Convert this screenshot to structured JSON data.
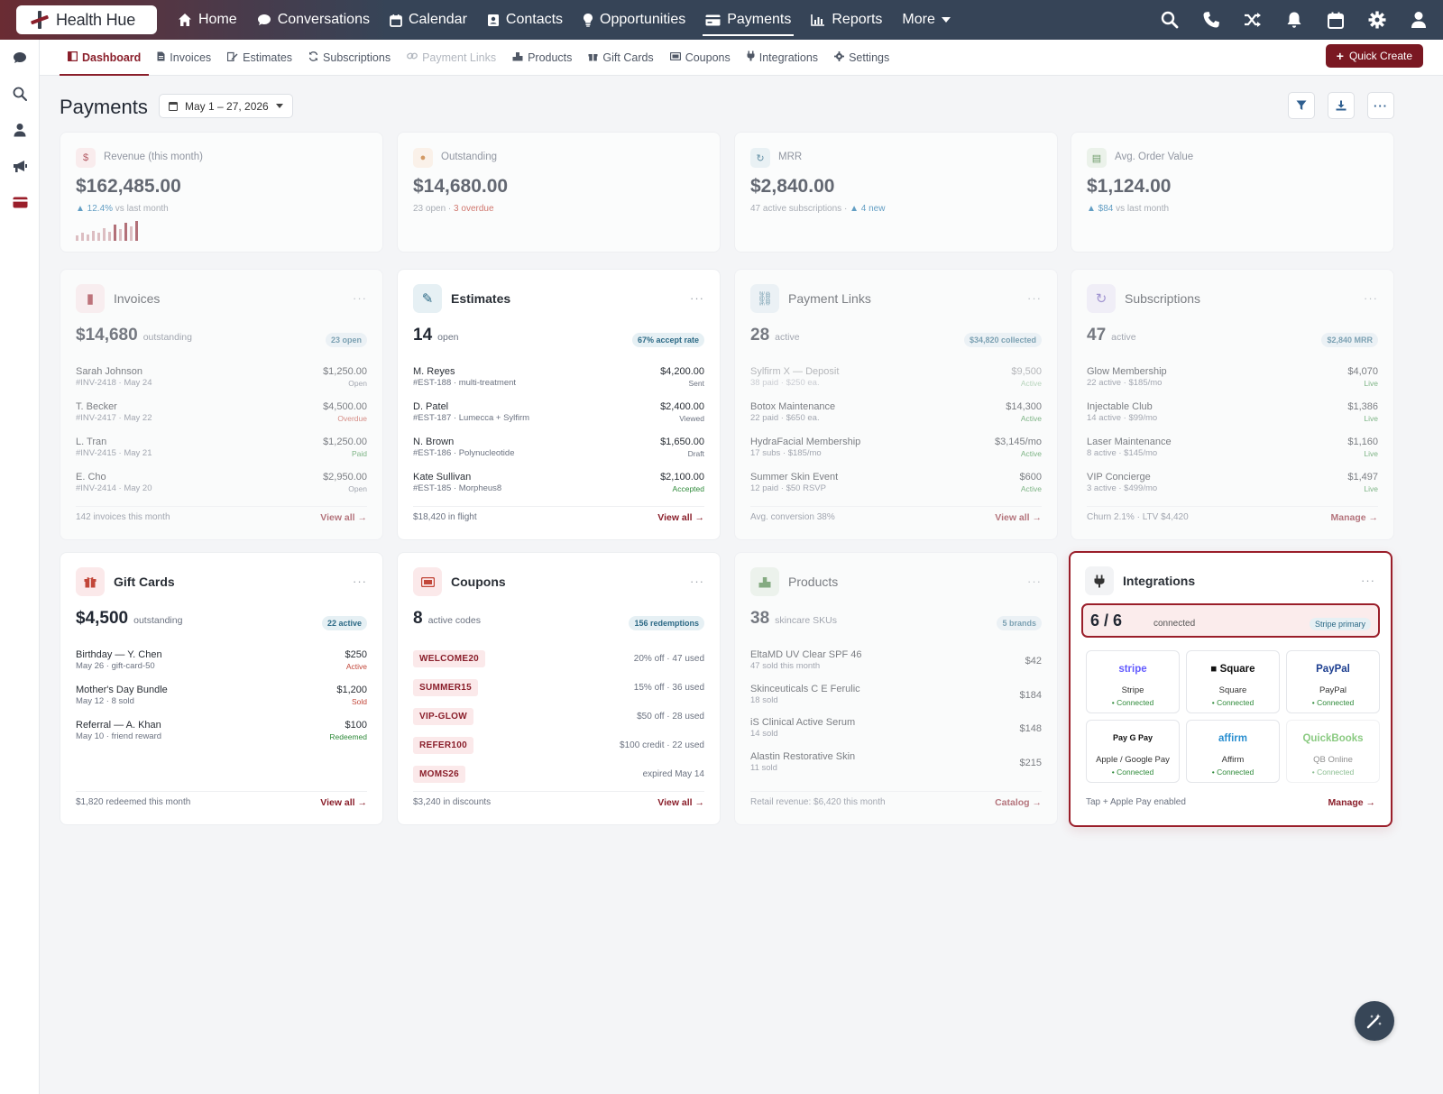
{
  "app": {
    "logo": "Health Hue"
  },
  "topnav": {
    "items": [
      {
        "label": "Home",
        "icon": "home-icon"
      },
      {
        "label": "Conversations",
        "icon": "chat-icon"
      },
      {
        "label": "Calendar",
        "icon": "calendar-icon"
      },
      {
        "label": "Contacts",
        "icon": "contacts-icon"
      },
      {
        "label": "Opportunities",
        "icon": "lightbulb-icon"
      },
      {
        "label": "Payments",
        "icon": "credit-card-icon"
      },
      {
        "label": "Reports",
        "icon": "bar-chart-icon"
      },
      {
        "label": "More",
        "icon": "chevron-down-icon"
      }
    ],
    "active": "Payments"
  },
  "subnav": {
    "items": [
      {
        "label": "Dashboard",
        "icon": "dashboard-icon"
      },
      {
        "label": "Invoices",
        "icon": "invoice-icon"
      },
      {
        "label": "Estimates",
        "icon": "estimate-icon"
      },
      {
        "label": "Subscriptions",
        "icon": "refresh-icon"
      },
      {
        "label": "Payment Links",
        "icon": "link-icon"
      },
      {
        "label": "Products",
        "icon": "products-icon"
      },
      {
        "label": "Gift Cards",
        "icon": "gift-icon"
      },
      {
        "label": "Coupons",
        "icon": "ticket-icon"
      },
      {
        "label": "Integrations",
        "icon": "plug-icon"
      },
      {
        "label": "Settings",
        "icon": "gear-icon"
      }
    ],
    "quick_create": "Quick Create"
  },
  "page": {
    "title": "Payments",
    "date_range": "May 1 – 27, 2026"
  },
  "stats": [
    {
      "label": "Revenue (this month)",
      "value": "$162,485.00",
      "sub_a": "▲ 12.4%",
      "sub_b": " vs last month"
    },
    {
      "label": "Outstanding",
      "value": "$14,680.00",
      "sub_a": "23 open · ",
      "sub_b": "3 overdue"
    },
    {
      "label": "MRR",
      "value": "$2,840.00",
      "sub_a": "47 active subscriptions · ",
      "sub_b": "▲ 4 new"
    },
    {
      "label": "Avg. Order Value",
      "value": "$1,124.00",
      "sub_a": "▲ $84",
      "sub_b": " vs last month"
    }
  ],
  "revenue_spark": [
    6,
    9,
    7,
    11,
    9,
    14,
    10,
    18,
    13,
    20,
    16,
    22
  ],
  "invoices": {
    "title": "Invoices",
    "big": "$14,680",
    "big_sub": "outstanding",
    "badge": "23 open",
    "rows": [
      {
        "name": "Sarah Johnson",
        "meta": "#INV-2418 · May 24",
        "amount": "$1,250.00",
        "status": "Open"
      },
      {
        "name": "T. Becker",
        "meta": "#INV-2417 · May 22",
        "amount": "$4,500.00",
        "status": "Overdue"
      },
      {
        "name": "L. Tran",
        "meta": "#INV-2415 · May 21",
        "amount": "$1,250.00",
        "status": "Paid"
      },
      {
        "name": "E. Cho",
        "meta": "#INV-2414 · May 20",
        "amount": "$2,950.00",
        "status": "Open"
      }
    ],
    "foot_left": "142 invoices this month",
    "foot_right": "View all →"
  },
  "estimates": {
    "title": "Estimates",
    "big": "14",
    "big_sub": "open",
    "badge": "67% accept rate",
    "rows": [
      {
        "name": "M. Reyes",
        "meta": "#EST-188 · multi-treatment",
        "amount": "$4,200.00",
        "status": "Sent"
      },
      {
        "name": "D. Patel",
        "meta": "#EST-187 · Lumecca + Sylfirm",
        "amount": "$2,400.00",
        "status": "Viewed"
      },
      {
        "name": "N. Brown",
        "meta": "#EST-186 · Polynucleotide",
        "amount": "$1,650.00",
        "status": "Draft"
      },
      {
        "name": "Kate Sullivan",
        "meta": "#EST-185 · Morpheus8",
        "amount": "$2,100.00",
        "status": "Accepted"
      }
    ],
    "foot_left": "$18,420 in flight",
    "foot_right": "View all →"
  },
  "payment_links": {
    "title": "Payment Links",
    "big": "28",
    "big_sub": "active",
    "badge": "$34,820 collected",
    "rows": [
      {
        "name": "Sylfirm X — Deposit",
        "meta": "38 paid · $250 ea.",
        "amount": "$9,500",
        "status": "Active"
      },
      {
        "name": "Botox Maintenance",
        "meta": "22 paid · $650 ea.",
        "amount": "$14,300",
        "status": "Active"
      },
      {
        "name": "HydraFacial Membership",
        "meta": "17 subs · $185/mo",
        "amount": "$3,145/mo",
        "status": "Active"
      },
      {
        "name": "Summer Skin Event",
        "meta": "12 paid · $50 RSVP",
        "amount": "$600",
        "status": "Active"
      }
    ],
    "foot_left": "Avg. conversion 38%",
    "foot_right": "View all →"
  },
  "subscriptions": {
    "title": "Subscriptions",
    "big": "47",
    "big_sub": "active",
    "badge": "$2,840 MRR",
    "rows": [
      {
        "name": "Glow Membership",
        "meta": "22 active · $185/mo",
        "amount": "$4,070",
        "status": "Live"
      },
      {
        "name": "Injectable Club",
        "meta": "14 active · $99/mo",
        "amount": "$1,386",
        "status": "Live"
      },
      {
        "name": "Laser Maintenance",
        "meta": "8 active · $145/mo",
        "amount": "$1,160",
        "status": "Live"
      },
      {
        "name": "VIP Concierge",
        "meta": "3 active · $499/mo",
        "amount": "$1,497",
        "status": "Live"
      }
    ],
    "foot_left": "Churn 2.1% · LTV $4,420",
    "foot_right": "Manage →"
  },
  "gift_cards": {
    "title": "Gift Cards",
    "big": "$4,500",
    "big_sub": "outstanding",
    "badge": "22 active",
    "rows": [
      {
        "name": "Birthday — Y. Chen",
        "meta": "May 26 · gift-card-50",
        "amount": "$250",
        "status": "Active"
      },
      {
        "name": "Mother's Day Bundle",
        "meta": "May 12 · 8 sold",
        "amount": "$1,200",
        "status": "Sold"
      },
      {
        "name": "Referral — A. Khan",
        "meta": "May 10 · friend reward",
        "amount": "$100",
        "status": "Redeemed"
      }
    ],
    "foot_left": "$1,820 redeemed this month",
    "foot_right": "View all →"
  },
  "coupons": {
    "title": "Coupons",
    "big": "8",
    "big_sub": "active codes",
    "badge": "156 redemptions",
    "rows": [
      {
        "code": "WELCOME20",
        "desc": "20% off · 47 used"
      },
      {
        "code": "SUMMER15",
        "desc": "15% off · 36 used"
      },
      {
        "code": "VIP-GLOW",
        "desc": "$50 off · 28 used"
      },
      {
        "code": "REFER100",
        "desc": "$100 credit · 22 used"
      },
      {
        "code": "MOMS26",
        "desc": "expired May 14"
      }
    ],
    "foot_left": "$3,240 in discounts",
    "foot_right": "View all →"
  },
  "products": {
    "title": "Products",
    "big": "38",
    "big_sub": "skincare SKUs",
    "badge": "5 brands",
    "rows": [
      {
        "name": "EltaMD UV Clear SPF 46",
        "meta": "47 sold this month",
        "amount": "$42"
      },
      {
        "name": "Skinceuticals C E Ferulic",
        "meta": "18 sold",
        "amount": "$184"
      },
      {
        "name": "iS Clinical Active Serum",
        "meta": "14 sold",
        "amount": "$148"
      },
      {
        "name": "Alastin Restorative Skin",
        "meta": "11 sold",
        "amount": "$215"
      }
    ],
    "foot_left": "Retail revenue: $6,420 this month",
    "foot_right": "Catalog →"
  },
  "integrations": {
    "title": "Integrations",
    "count": "6 / 6",
    "count_sub": "connected",
    "badge": "Stripe primary",
    "tiles": [
      {
        "logo": "stripe",
        "name": "Stripe",
        "status": "• Connected",
        "color": "#635bff"
      },
      {
        "logo": "■ Square",
        "name": "Square",
        "status": "• Connected",
        "color": "#111111"
      },
      {
        "logo": "PayPal",
        "name": "PayPal",
        "status": "• Connected",
        "color": "#1b3d8f"
      },
      {
        "logo": " Pay  G Pay",
        "name": "Apple / Google Pay",
        "status": "• Connected",
        "color": "#111111"
      },
      {
        "logo": "affirm",
        "name": "Affirm",
        "status": "• Connected",
        "color": "#2a8fd0"
      },
      {
        "logo": "QuickBooks",
        "name": "QB Online",
        "status": "• Connected",
        "color": "#2ca01c"
      }
    ],
    "foot_left": "Tap + Apple Pay enabled",
    "foot_right": "Manage →"
  },
  "colors": {
    "brand": "#8a1f2b",
    "nav": "#364457",
    "green": "#2f8a3a",
    "info": "#2d6a86"
  }
}
